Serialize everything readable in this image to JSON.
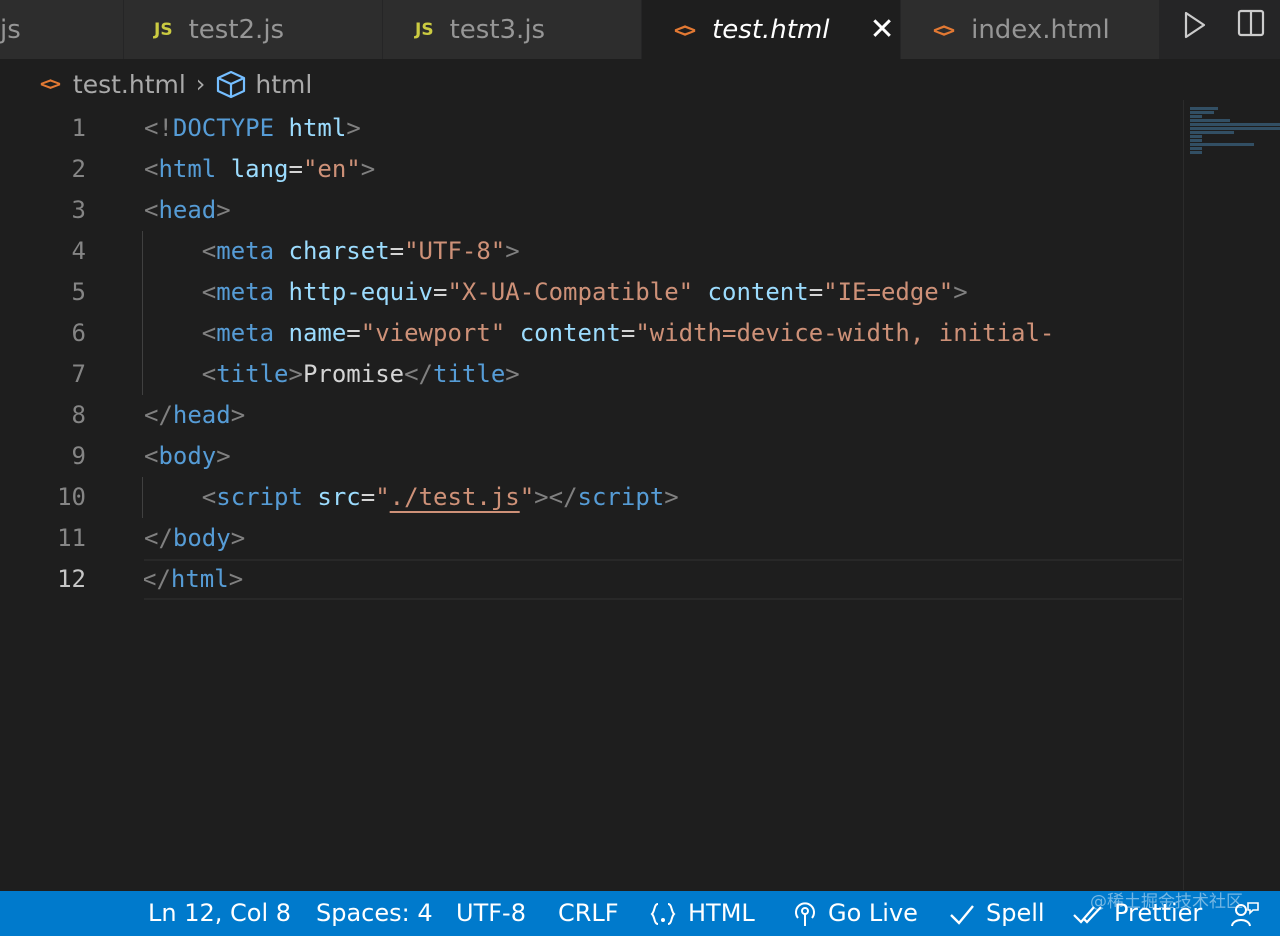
{
  "tabs": [
    {
      "label": "js",
      "kind": "js-partial"
    },
    {
      "label": "test2.js",
      "kind": "js",
      "badge": "JS"
    },
    {
      "label": "test3.js",
      "kind": "js",
      "badge": "JS"
    },
    {
      "label": "test.html",
      "kind": "html",
      "badge": "<>",
      "active": true,
      "close": "✕"
    },
    {
      "label": "index.html",
      "kind": "html",
      "badge": "<>"
    }
  ],
  "breadcrumb": {
    "icon": "<>",
    "file": "test.html",
    "separator": "›",
    "symbol": "html"
  },
  "editor": {
    "current_line": 12,
    "line_numbers": [
      "1",
      "2",
      "3",
      "4",
      "5",
      "6",
      "7",
      "8",
      "9",
      "10",
      "11",
      "12"
    ]
  },
  "statusbar": {
    "position": "Ln 12, Col 8",
    "spaces": "Spaces: 4",
    "encoding": "UTF-8",
    "eol": "CRLF",
    "language": "HTML",
    "go_live": "Go Live",
    "spell": "Spell",
    "prettier": "Prettier",
    "watermark": "@稀土掘金技术社区"
  },
  "colors": {
    "accent": "#007acc",
    "js_badge": "#cbcb41",
    "html_badge": "#e37933",
    "tag": "#569cd6",
    "attribute": "#9cdcfe",
    "string": "#ce9178"
  }
}
